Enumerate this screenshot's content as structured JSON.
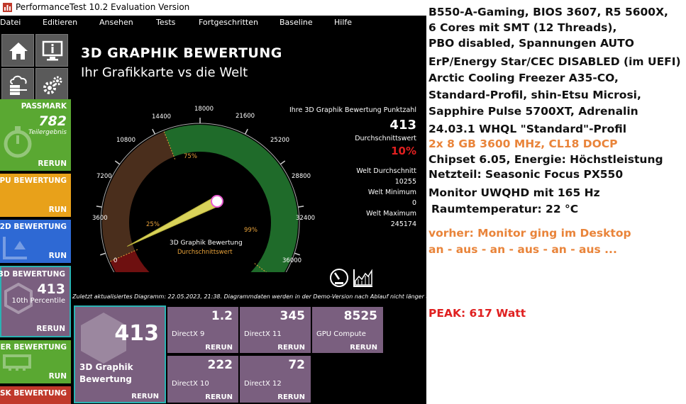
{
  "window": {
    "title": "PerformanceTest 10.2 Evaluation Version"
  },
  "menu": [
    "Datei",
    "Editieren",
    "Ansehen",
    "Tests",
    "Fortgeschritten",
    "Baseline",
    "Hilfe"
  ],
  "nav": {
    "home": "home-icon",
    "monitor": "monitor-info-icon",
    "cloud": "cloud-server-icon",
    "gears": "gears-icon"
  },
  "sidebar": {
    "passmark": {
      "title": "PASSMARK",
      "score": "782",
      "sub": "Teilergebnis",
      "rerun": "RERUN",
      "color": "#5aa832"
    },
    "cpu": {
      "title": "CPU BEWERTUNG",
      "rerun": "RUN",
      "color": "#e8a11a"
    },
    "d2": {
      "title": "2D BEWERTUNG",
      "rerun": "RUN",
      "color": "#2e69d4"
    },
    "d3": {
      "title": "3D BEWERTUNG",
      "score": "413",
      "sub": "10th Percentile",
      "rerun": "RERUN",
      "color": "#7a5f7f"
    },
    "mem": {
      "title": "CHER BEWERTUNG",
      "rerun": "RUN",
      "color": "#5aa832"
    },
    "disk": {
      "title": "DISK BEWERTUNG",
      "color": "#c0392b"
    }
  },
  "main": {
    "heading": "3D GRAPHIK BEWERTUNG",
    "subheading": "Ihr Grafikkarte vs die Welt",
    "your_label": "Ihre 3D Graphik Bewertung Punktzahl",
    "your_score": "413",
    "avg_label": "Durchschnittswert",
    "avg_pct": "10%",
    "world_avg_label": "Welt Durchschnitt",
    "world_avg": "10255",
    "world_min_label": "Welt Minimum",
    "world_min": "0",
    "world_max_label": "Welt Maximum",
    "world_max": "245174",
    "gauge": {
      "ticks": [
        "0",
        "3600",
        "7200",
        "10800",
        "14400",
        "18000",
        "21600",
        "25200",
        "28800",
        "32400",
        "36000"
      ],
      "center_title": "3D Graphik Bewertung",
      "center_sub": "Durchschnittswert",
      "pct_labels": [
        "25%",
        "75%",
        "99%"
      ],
      "max": 36000,
      "needle_value": 10255
    },
    "note": "Zuletzt aktualisiertes Diagramm: 22.05.2023, 21:38. Diagrammdaten werden in der Demo-Version nach Ablauf nicht länger aktualisiert",
    "summary": {
      "score": "413",
      "label1": "3D Graphik",
      "label2": "Bewertung",
      "rerun": "RERUN"
    },
    "tests": [
      {
        "value": "1.2",
        "label": "DirectX 9",
        "rerun": "RERUN"
      },
      {
        "value": "345",
        "label": "DirectX 11",
        "rerun": "RERUN"
      },
      {
        "value": "8525",
        "label": "GPU Compute",
        "rerun": "RERUN"
      },
      {
        "value": "222",
        "label": "DirectX 10",
        "rerun": "RERUN"
      },
      {
        "value": "72",
        "label": "DirectX 12",
        "rerun": "RERUN"
      }
    ]
  },
  "notes": [
    "B550-A-Gaming, BIOS 3607, R5 5600X,",
    "6 Cores mit SMT (12 Threads),",
    "PBO disabled, Spannungen AUTO",
    "ErP/Energy Star/CEC DISABLED (im UEFI)",
    "Arctic Cooling Freezer A35-CO,",
    "Standard-Profil, shin-Etsu Microsi,",
    "Sapphire Pulse 5700XT, Adrenalin",
    "24.03.1 WHQL \"Standard\"-Profil",
    "2x 8 GB 3600 MHz, CL18 DOCP",
    "Chipset 6.05, Energie: Höchstleistung",
    "Netzteil: Seasonic Focus PX550",
    "Monitor UWQHD mit 165 Hz",
    "Raumtemperatur: 22 °C",
    "vorher: Monitor ging im Desktop",
    "an - aus - an - aus - an - aus ...",
    "PEAK: 617 Watt"
  ]
}
